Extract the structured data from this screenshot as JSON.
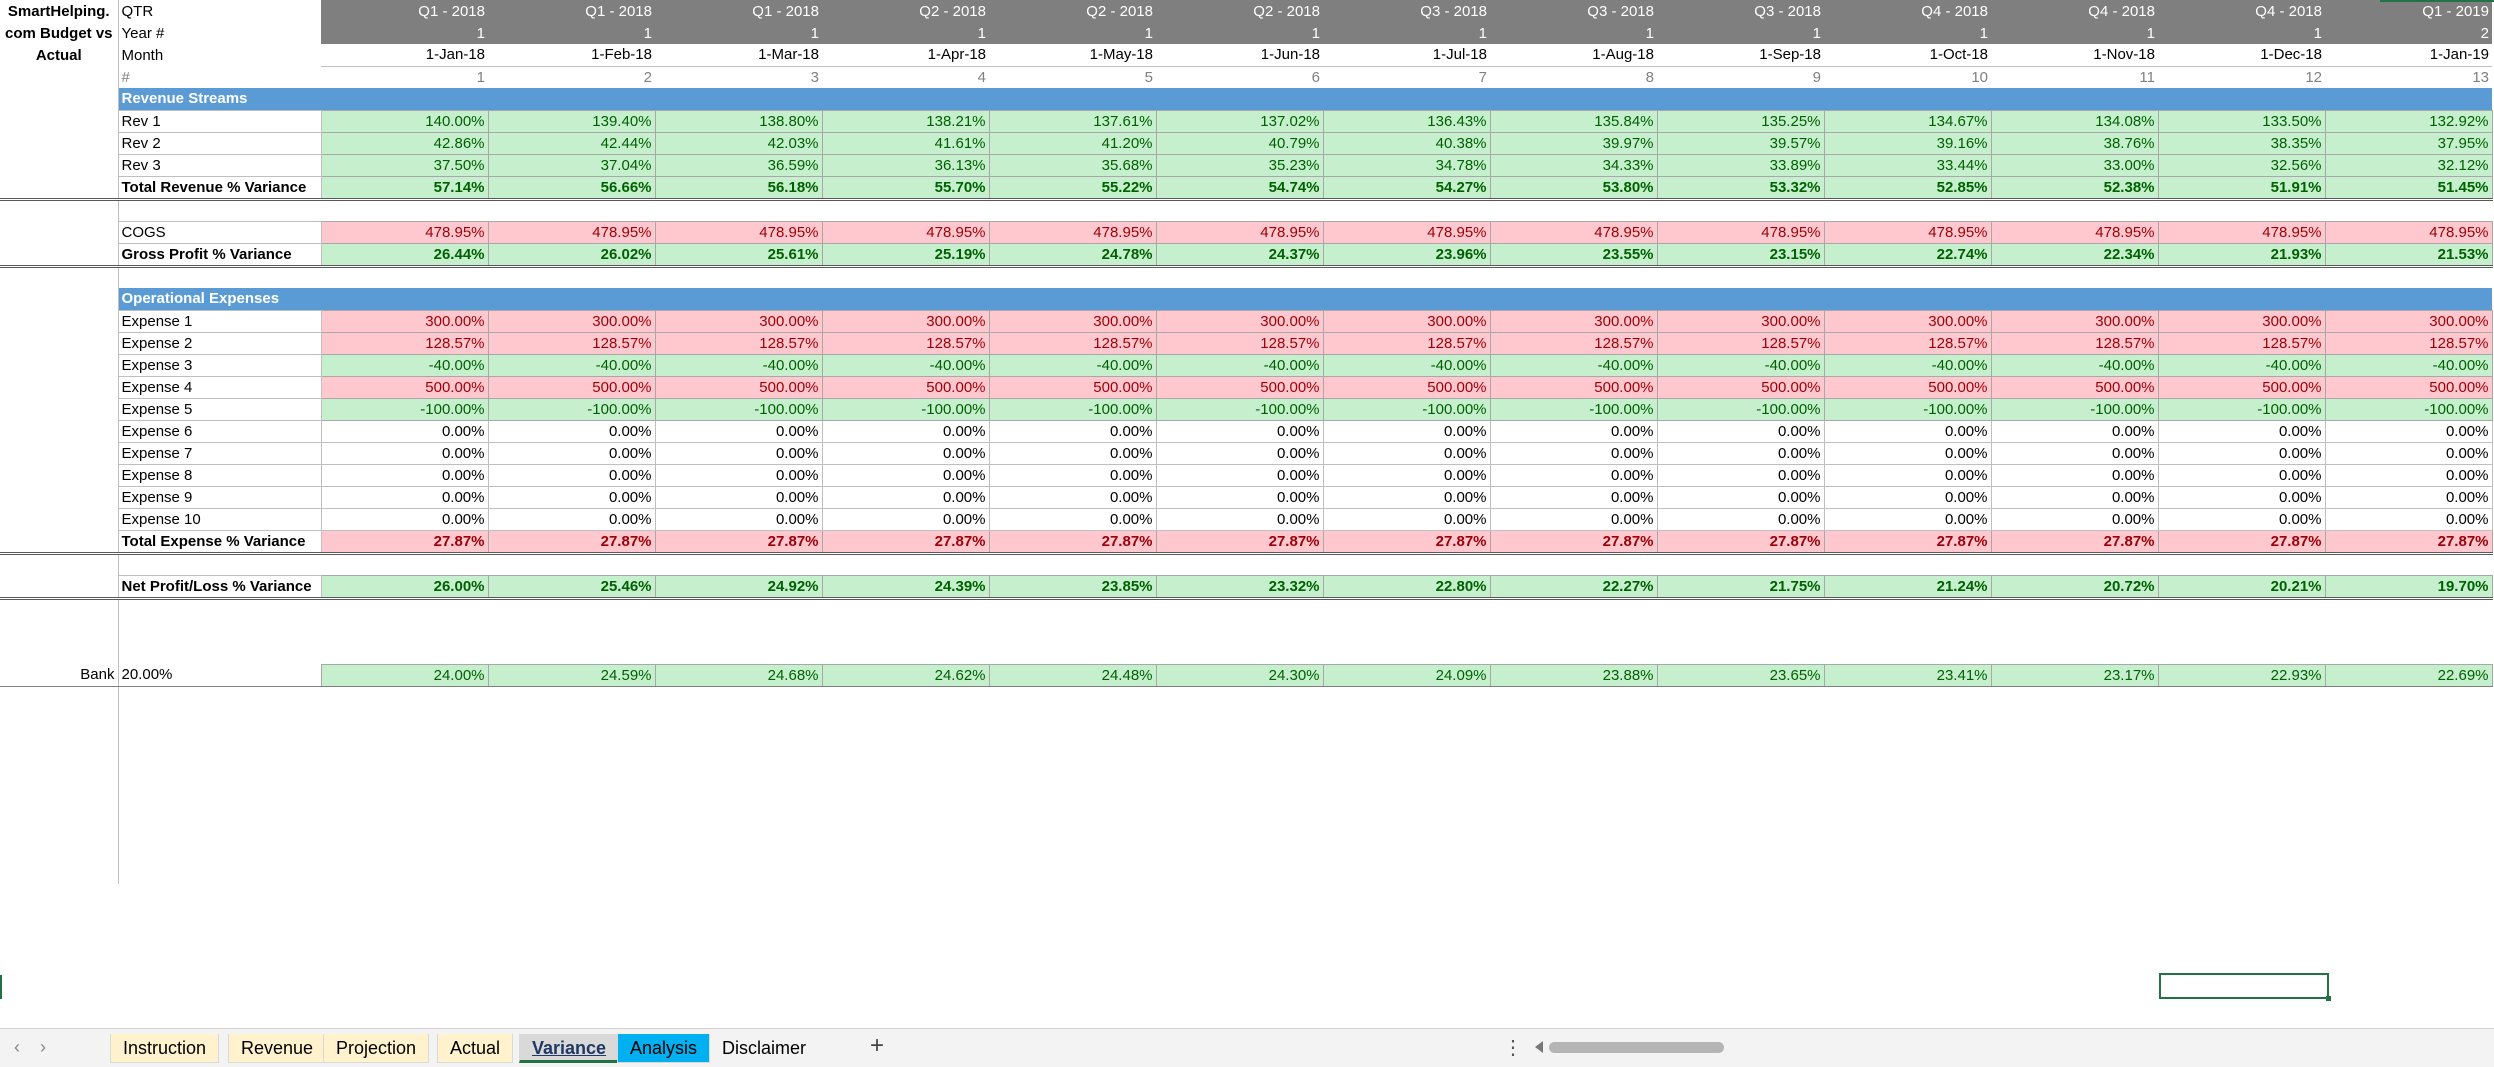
{
  "title_lines": [
    "SmartHelping.",
    "com Budget vs",
    "Actual"
  ],
  "header_labels": {
    "qtr": "QTR",
    "year": "Year #",
    "month": "Month",
    "index": "#"
  },
  "columns": [
    {
      "qtr": "Q1 - 2018",
      "year": "1",
      "month": "1-Jan-18",
      "idx": "1"
    },
    {
      "qtr": "Q1 - 2018",
      "year": "1",
      "month": "1-Feb-18",
      "idx": "2"
    },
    {
      "qtr": "Q1 - 2018",
      "year": "1",
      "month": "1-Mar-18",
      "idx": "3"
    },
    {
      "qtr": "Q2 - 2018",
      "year": "1",
      "month": "1-Apr-18",
      "idx": "4"
    },
    {
      "qtr": "Q2 - 2018",
      "year": "1",
      "month": "1-May-18",
      "idx": "5"
    },
    {
      "qtr": "Q2 - 2018",
      "year": "1",
      "month": "1-Jun-18",
      "idx": "6"
    },
    {
      "qtr": "Q3 - 2018",
      "year": "1",
      "month": "1-Jul-18",
      "idx": "7"
    },
    {
      "qtr": "Q3 - 2018",
      "year": "1",
      "month": "1-Aug-18",
      "idx": "8"
    },
    {
      "qtr": "Q3 - 2018",
      "year": "1",
      "month": "1-Sep-18",
      "idx": "9"
    },
    {
      "qtr": "Q4 - 2018",
      "year": "1",
      "month": "1-Oct-18",
      "idx": "10"
    },
    {
      "qtr": "Q4 - 2018",
      "year": "1",
      "month": "1-Nov-18",
      "idx": "11"
    },
    {
      "qtr": "Q4 - 2018",
      "year": "1",
      "month": "1-Dec-18",
      "idx": "12"
    },
    {
      "qtr": "Q1 - 2019",
      "year": "2",
      "month": "1-Jan-19",
      "idx": "13"
    }
  ],
  "rows": [
    {
      "type": "section",
      "label": "Revenue Streams"
    },
    {
      "type": "data",
      "label": "Rev 1",
      "style": "green",
      "values": [
        "140.00%",
        "139.40%",
        "138.80%",
        "138.21%",
        "137.61%",
        "137.02%",
        "136.43%",
        "135.84%",
        "135.25%",
        "134.67%",
        "134.08%",
        "133.50%",
        "132.92%"
      ]
    },
    {
      "type": "data",
      "label": "Rev 2",
      "style": "green",
      "values": [
        "42.86%",
        "42.44%",
        "42.03%",
        "41.61%",
        "41.20%",
        "40.79%",
        "40.38%",
        "39.97%",
        "39.57%",
        "39.16%",
        "38.76%",
        "38.35%",
        "37.95%"
      ]
    },
    {
      "type": "data",
      "label": "Rev 3",
      "style": "green",
      "values": [
        "37.50%",
        "37.04%",
        "36.59%",
        "36.13%",
        "35.68%",
        "35.23%",
        "34.78%",
        "34.33%",
        "33.89%",
        "33.44%",
        "33.00%",
        "32.56%",
        "32.12%"
      ]
    },
    {
      "type": "total",
      "label": "Total Revenue % Variance",
      "style": "green",
      "values": [
        "57.14%",
        "56.66%",
        "56.18%",
        "55.70%",
        "55.22%",
        "54.74%",
        "54.27%",
        "53.80%",
        "53.32%",
        "52.85%",
        "52.38%",
        "51.91%",
        "51.45%"
      ]
    },
    {
      "type": "blank"
    },
    {
      "type": "data",
      "label": "COGS",
      "style": "red",
      "values": [
        "478.95%",
        "478.95%",
        "478.95%",
        "478.95%",
        "478.95%",
        "478.95%",
        "478.95%",
        "478.95%",
        "478.95%",
        "478.95%",
        "478.95%",
        "478.95%",
        "478.95%"
      ]
    },
    {
      "type": "total",
      "label": "Gross Profit % Variance",
      "style": "green",
      "values": [
        "26.44%",
        "26.02%",
        "25.61%",
        "25.19%",
        "24.78%",
        "24.37%",
        "23.96%",
        "23.55%",
        "23.15%",
        "22.74%",
        "22.34%",
        "21.93%",
        "21.53%"
      ]
    },
    {
      "type": "blank"
    },
    {
      "type": "section",
      "label": "Operational Expenses"
    },
    {
      "type": "data",
      "label": "Expense 1",
      "style": "red",
      "values": [
        "300.00%",
        "300.00%",
        "300.00%",
        "300.00%",
        "300.00%",
        "300.00%",
        "300.00%",
        "300.00%",
        "300.00%",
        "300.00%",
        "300.00%",
        "300.00%",
        "300.00%"
      ]
    },
    {
      "type": "data",
      "label": "Expense 2",
      "style": "red",
      "values": [
        "128.57%",
        "128.57%",
        "128.57%",
        "128.57%",
        "128.57%",
        "128.57%",
        "128.57%",
        "128.57%",
        "128.57%",
        "128.57%",
        "128.57%",
        "128.57%",
        "128.57%"
      ]
    },
    {
      "type": "data",
      "label": "Expense 3",
      "style": "green",
      "values": [
        "-40.00%",
        "-40.00%",
        "-40.00%",
        "-40.00%",
        "-40.00%",
        "-40.00%",
        "-40.00%",
        "-40.00%",
        "-40.00%",
        "-40.00%",
        "-40.00%",
        "-40.00%",
        "-40.00%"
      ]
    },
    {
      "type": "data",
      "label": "Expense 4",
      "style": "red",
      "values": [
        "500.00%",
        "500.00%",
        "500.00%",
        "500.00%",
        "500.00%",
        "500.00%",
        "500.00%",
        "500.00%",
        "500.00%",
        "500.00%",
        "500.00%",
        "500.00%",
        "500.00%"
      ]
    },
    {
      "type": "data",
      "label": "Expense 5",
      "style": "green",
      "values": [
        "-100.00%",
        "-100.00%",
        "-100.00%",
        "-100.00%",
        "-100.00%",
        "-100.00%",
        "-100.00%",
        "-100.00%",
        "-100.00%",
        "-100.00%",
        "-100.00%",
        "-100.00%",
        "-100.00%"
      ]
    },
    {
      "type": "data",
      "label": "Expense 6",
      "style": "plain",
      "values": [
        "0.00%",
        "0.00%",
        "0.00%",
        "0.00%",
        "0.00%",
        "0.00%",
        "0.00%",
        "0.00%",
        "0.00%",
        "0.00%",
        "0.00%",
        "0.00%",
        "0.00%"
      ]
    },
    {
      "type": "data",
      "label": "Expense 7",
      "style": "plain",
      "values": [
        "0.00%",
        "0.00%",
        "0.00%",
        "0.00%",
        "0.00%",
        "0.00%",
        "0.00%",
        "0.00%",
        "0.00%",
        "0.00%",
        "0.00%",
        "0.00%",
        "0.00%"
      ]
    },
    {
      "type": "data",
      "label": "Expense 8",
      "style": "plain",
      "values": [
        "0.00%",
        "0.00%",
        "0.00%",
        "0.00%",
        "0.00%",
        "0.00%",
        "0.00%",
        "0.00%",
        "0.00%",
        "0.00%",
        "0.00%",
        "0.00%",
        "0.00%"
      ]
    },
    {
      "type": "data",
      "label": "Expense 9",
      "style": "plain",
      "values": [
        "0.00%",
        "0.00%",
        "0.00%",
        "0.00%",
        "0.00%",
        "0.00%",
        "0.00%",
        "0.00%",
        "0.00%",
        "0.00%",
        "0.00%",
        "0.00%",
        "0.00%"
      ]
    },
    {
      "type": "data",
      "label": "Expense 10",
      "style": "plain",
      "values": [
        "0.00%",
        "0.00%",
        "0.00%",
        "0.00%",
        "0.00%",
        "0.00%",
        "0.00%",
        "0.00%",
        "0.00%",
        "0.00%",
        "0.00%",
        "0.00%",
        "0.00%"
      ]
    },
    {
      "type": "total",
      "label": "Total Expense % Variance",
      "style": "red",
      "values": [
        "27.87%",
        "27.87%",
        "27.87%",
        "27.87%",
        "27.87%",
        "27.87%",
        "27.87%",
        "27.87%",
        "27.87%",
        "27.87%",
        "27.87%",
        "27.87%",
        "27.87%"
      ]
    },
    {
      "type": "blank"
    },
    {
      "type": "total",
      "label": "Net Profit/Loss % Variance",
      "style": "green",
      "values": [
        "26.00%",
        "25.46%",
        "24.92%",
        "24.39%",
        "23.85%",
        "23.32%",
        "22.80%",
        "22.27%",
        "21.75%",
        "21.24%",
        "20.72%",
        "20.21%",
        "19.70%"
      ]
    },
    {
      "type": "blank"
    },
    {
      "type": "blank"
    },
    {
      "type": "blank"
    },
    {
      "type": "bank",
      "prefix": "Bank",
      "label": "20.00%",
      "style": "green",
      "values": [
        "24.00%",
        "24.59%",
        "24.68%",
        "24.62%",
        "24.48%",
        "24.30%",
        "24.09%",
        "23.88%",
        "23.65%",
        "23.41%",
        "23.17%",
        "22.93%",
        "22.69%"
      ]
    }
  ],
  "tabs": [
    {
      "label": "Instruction",
      "kind": "yellow"
    },
    {
      "label": "Revenue",
      "kind": "yellow"
    },
    {
      "label": "Projection",
      "kind": "yellow"
    },
    {
      "label": "Actual",
      "kind": "yellow"
    },
    {
      "label": "Variance",
      "kind": "active"
    },
    {
      "label": "Analysis",
      "kind": "blue"
    },
    {
      "label": "Disclaimer",
      "kind": "plain"
    }
  ],
  "add_sheet_label": "+",
  "colors": {
    "green_fill": "#c6efce",
    "green_text": "#006100",
    "red_fill": "#ffc7ce",
    "red_text": "#9c0006",
    "section_blue": "#5b9bd5",
    "header_gray": "#7f7f7f",
    "selection": "#217346"
  }
}
